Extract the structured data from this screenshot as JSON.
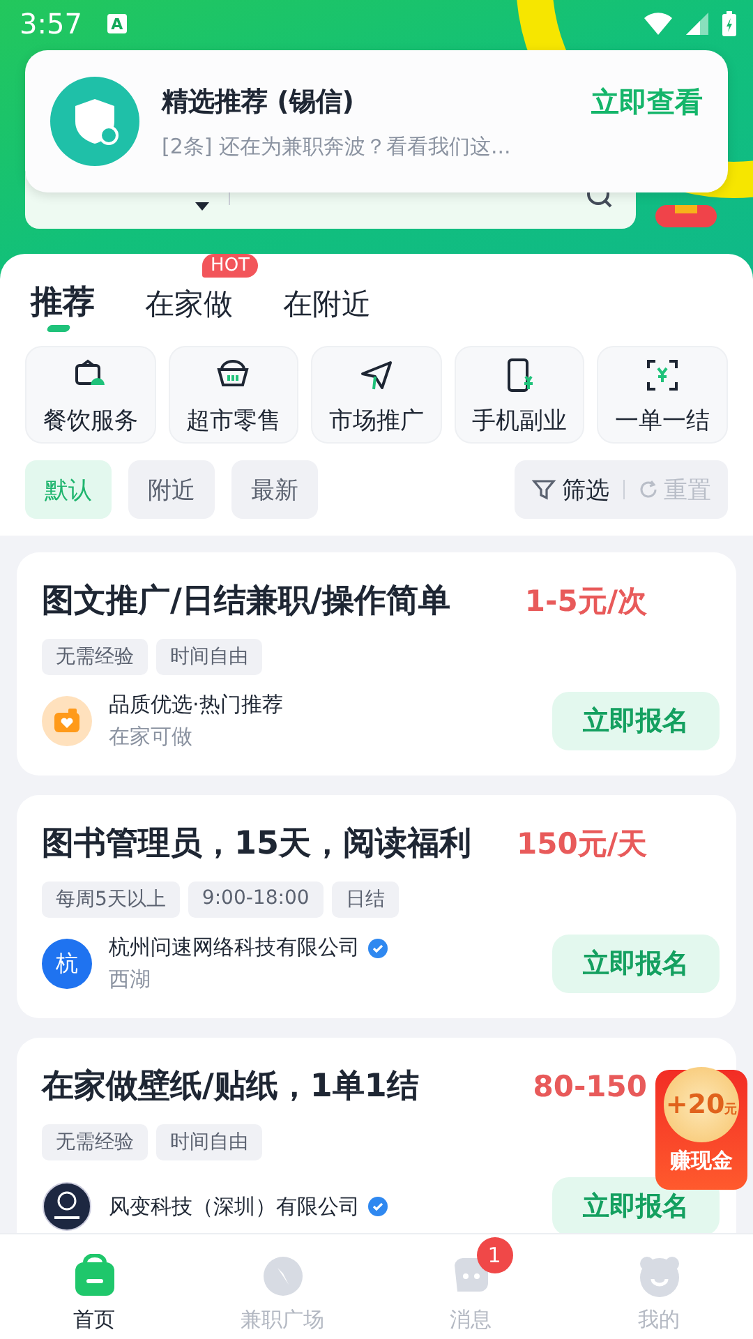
{
  "status_bar": {
    "time": "3:57",
    "app_badge": "A"
  },
  "notification": {
    "title": "精选推荐 (锡信)",
    "body": "[2条] 还在为兼职奔波？看看我们这...",
    "action": "立即查看"
  },
  "tabs": [
    {
      "label": "推荐",
      "selected": true
    },
    {
      "label": "在家做",
      "selected": false,
      "badge": "HOT"
    },
    {
      "label": "在附近",
      "selected": false
    }
  ],
  "categories": [
    {
      "label": "餐饮服务",
      "kind": "dining"
    },
    {
      "label": "超市零售",
      "kind": "basket"
    },
    {
      "label": "市场推广",
      "kind": "plane"
    },
    {
      "label": "手机副业",
      "kind": "phone"
    },
    {
      "label": "一单一结",
      "kind": "settle"
    }
  ],
  "sort_chips": [
    {
      "label": "默认",
      "selected": true
    },
    {
      "label": "附近",
      "selected": false
    },
    {
      "label": "最新",
      "selected": false
    }
  ],
  "filter": {
    "label": "筛选",
    "reset": "重置",
    "reset_disabled": true
  },
  "jobs": [
    {
      "title": "图文推广/日结兼职/操作简单",
      "price": "1-5元/次",
      "tags": [
        "无需经验",
        "时间自由"
      ],
      "logo": {
        "kind": "camera"
      },
      "company": "品质优选·热门推荐",
      "verified": false,
      "location": "在家可做",
      "action": "立即报名"
    },
    {
      "title": "图书管理员，15天，阅读福利",
      "price": "150元/天",
      "tags": [
        "每周5天以上",
        "9:00-18:00",
        "日结"
      ],
      "logo": {
        "kind": "initial",
        "text": "杭"
      },
      "company": "杭州问速网络科技有限公司",
      "verified": true,
      "location": "西湖",
      "action": "立即报名"
    },
    {
      "title": "在家做壁纸/贴纸，1单1结",
      "price": "80-150",
      "tags": [
        "无需经验",
        "时间自由"
      ],
      "logo": {
        "kind": "emblem"
      },
      "company": "风变科技（深圳）有限公司",
      "verified": true,
      "action": "立即报名"
    }
  ],
  "floating_reward": {
    "amount": "+20",
    "unit": "元",
    "label": "赚现金"
  },
  "nav": [
    {
      "label": "首页",
      "kind": "home",
      "selected": true
    },
    {
      "label": "兼职广场",
      "kind": "compass",
      "selected": false
    },
    {
      "label": "消息",
      "kind": "chat",
      "selected": false,
      "badge": "1"
    },
    {
      "label": "我的",
      "kind": "bear",
      "selected": false
    }
  ]
}
